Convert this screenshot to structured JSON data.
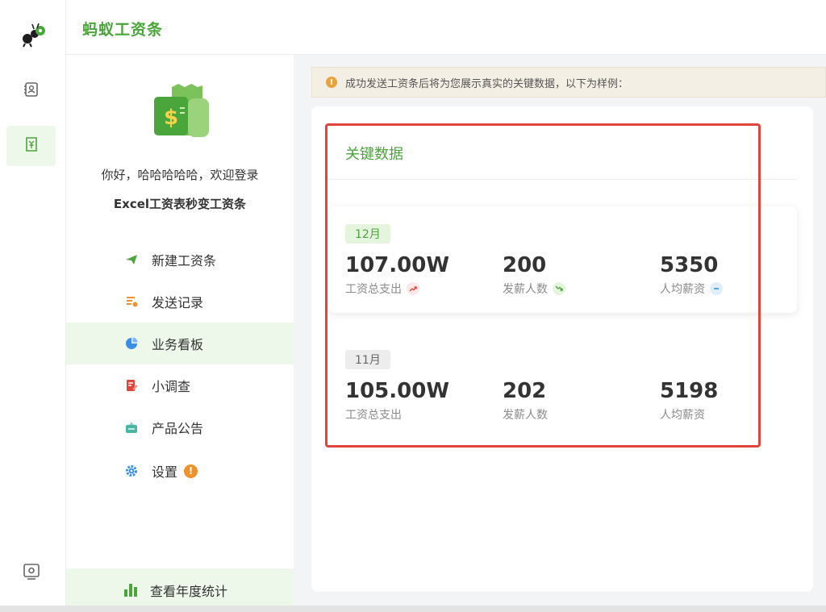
{
  "app": {
    "brand": "蚂蚁工资条"
  },
  "rail": {
    "items": [
      {
        "icon": "contacts-icon"
      },
      {
        "icon": "payslip-icon",
        "active": true
      },
      {
        "icon": "settings-box-icon"
      }
    ]
  },
  "profile": {
    "greeting": "你好，哈哈哈哈哈，欢迎登录",
    "slogan": "Excel工资表秒变工资条"
  },
  "menu": {
    "items": [
      {
        "label": "新建工资条",
        "icon": "send-icon",
        "color": "#4aa53a"
      },
      {
        "label": "发送记录",
        "icon": "record-icon",
        "color": "#f0922b"
      },
      {
        "label": "业务看板",
        "icon": "pie-icon",
        "color": "#3b8ee8",
        "active": true
      },
      {
        "label": "小调查",
        "icon": "survey-icon",
        "color": "#e0443a"
      },
      {
        "label": "产品公告",
        "icon": "announcement-icon",
        "color": "#4ab5a5"
      },
      {
        "label": "设置",
        "icon": "gear-icon",
        "color": "#3b8ee8",
        "badge": "!"
      }
    ],
    "yearly": "查看年度统计"
  },
  "notice": {
    "text": "成功发送工资条后将为您展示真实的关键数据，以下为样例：",
    "icon": "!"
  },
  "key_data": {
    "title": "关键数据",
    "months": [
      {
        "month": "12月",
        "stats": [
          {
            "value": "107.00W",
            "label": "工资总支出",
            "trend": "up"
          },
          {
            "value": "200",
            "label": "发薪人数",
            "trend": "down"
          },
          {
            "value": "5350",
            "label": "人均薪资",
            "trend": "flat"
          }
        ]
      },
      {
        "month": "11月",
        "stats": [
          {
            "value": "105.00W",
            "label": "工资总支出"
          },
          {
            "value": "202",
            "label": "发薪人数"
          },
          {
            "value": "5198",
            "label": "人均薪资"
          }
        ]
      }
    ]
  },
  "colors": {
    "brand_green": "#4aa53a",
    "highlight_red": "#e0443a",
    "warning_orange": "#f0922b"
  }
}
